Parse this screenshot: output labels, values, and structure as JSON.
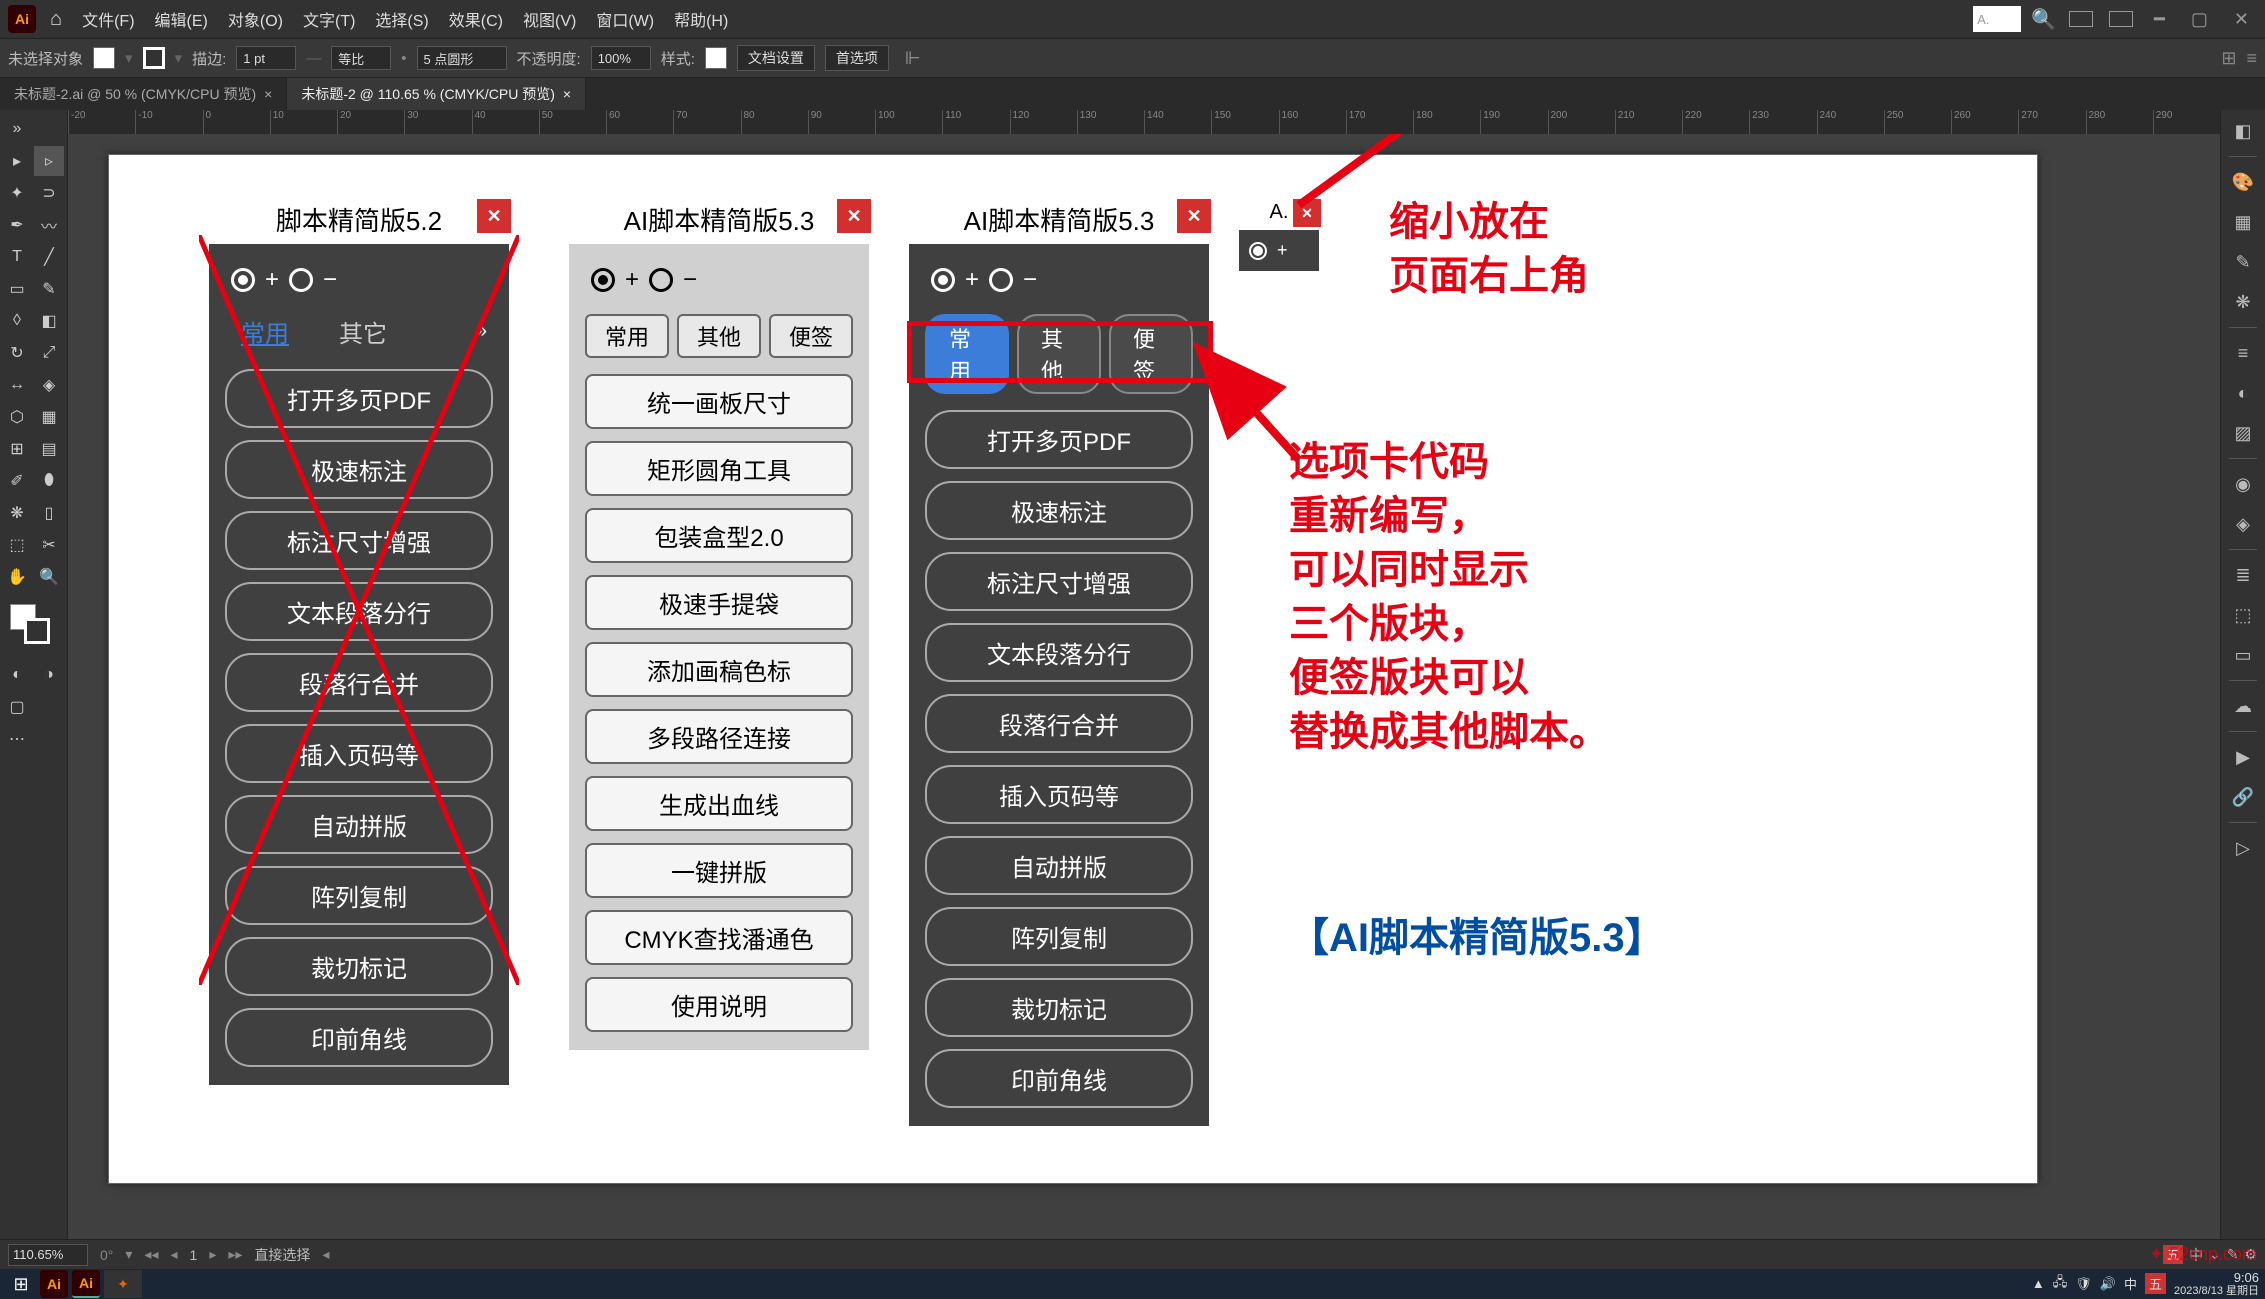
{
  "menubar": {
    "items": [
      "文件(F)",
      "编辑(E)",
      "对象(O)",
      "文字(T)",
      "选择(S)",
      "效果(C)",
      "视图(V)",
      "窗口(W)",
      "帮助(H)"
    ],
    "top_input": "A.",
    "logo": "Ai"
  },
  "controlbar": {
    "no_selection": "未选择对象",
    "stroke_label": "描边:",
    "stroke_value": "1 pt",
    "uniform": "等比",
    "brush_label": "5 点圆形",
    "opacity_label": "不透明度:",
    "opacity_value": "100%",
    "style_label": "样式:",
    "doc_setup": "文档设置",
    "prefs": "首选项"
  },
  "doctabs": {
    "tab1": "未标题-2.ai @ 50 % (CMYK/CPU 预览)",
    "tab2": "未标题-2 @ 110.65 % (CMYK/CPU 预览)"
  },
  "panels": {
    "p1": {
      "title": "脚本精简版5.2",
      "tabs": [
        "常用",
        "其它"
      ],
      "buttons": [
        "打开多页PDF",
        "极速标注",
        "标注尺寸增强",
        "文本段落分行",
        "段落行合并",
        "插入页码等",
        "自动拼版",
        "阵列复制",
        "裁切标记",
        "印前角线"
      ]
    },
    "p2": {
      "title": "AI脚本精简版5.3",
      "tabs": [
        "常用",
        "其他",
        "便签"
      ],
      "buttons": [
        "统一画板尺寸",
        "矩形圆角工具",
        "包装盒型2.0",
        "极速手提袋",
        "添加画稿色标",
        "多段路径连接",
        "生成出血线",
        "一键拼版",
        "CMYK查找潘通色",
        "使用说明"
      ]
    },
    "p3": {
      "title": "AI脚本精简版5.3",
      "tabs": [
        "常用",
        "其他",
        "便签"
      ],
      "buttons": [
        "打开多页PDF",
        "极速标注",
        "标注尺寸增强",
        "文本段落分行",
        "段落行合并",
        "插入页码等",
        "自动拼版",
        "阵列复制",
        "裁切标记",
        "印前角线"
      ]
    },
    "p4": {
      "title": "A."
    }
  },
  "annotations": {
    "top_right": "缩小放在\n页面右上角",
    "middle": "选项卡代码\n重新编写，\n可以同时显示\n三个版块，\n便签版块可以\n替换成其他脚本。",
    "bottom_blue": "【AI脚本精简版5.3】"
  },
  "statusbar": {
    "zoom": "110.65%",
    "tool": "直接选择"
  },
  "taskbar": {
    "time": "9:06",
    "date": "2023/8/13 星期日"
  },
  "ruler_ticks": [
    "-20",
    "-10",
    "0",
    "10",
    "20",
    "30",
    "40",
    "50",
    "60",
    "70",
    "80",
    "90",
    "100",
    "110",
    "120",
    "130",
    "140",
    "150",
    "160",
    "170",
    "180",
    "190",
    "200",
    "210",
    "220",
    "230",
    "240",
    "250",
    "260",
    "270",
    "280",
    "290"
  ],
  "tray": {
    "ime_label": "中",
    "lang_label": "五"
  },
  "watermark": "52cnp.com"
}
